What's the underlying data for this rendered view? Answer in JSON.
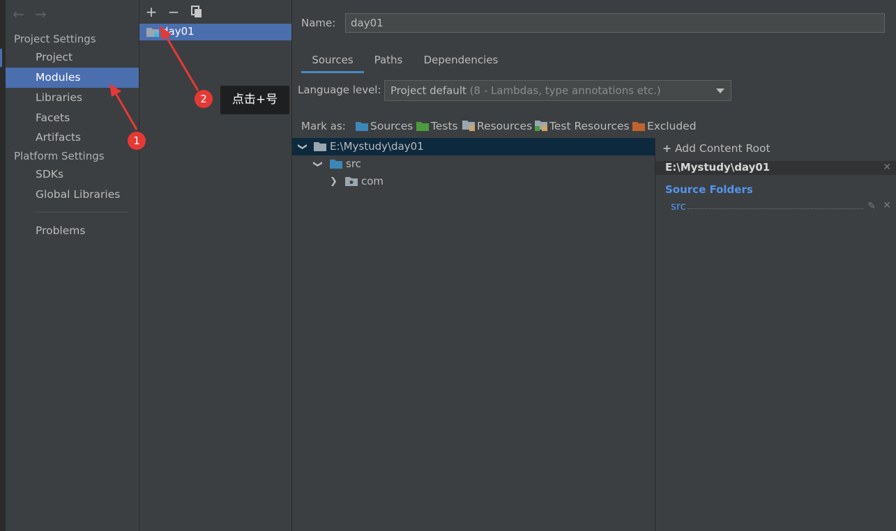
{
  "sidebar": {
    "project_settings_heading": "Project Settings",
    "platform_settings_heading": "Platform Settings",
    "items": {
      "project": "Project",
      "modules": "Modules",
      "libraries": "Libraries",
      "facets": "Facets",
      "artifacts": "Artifacts",
      "sdks": "SDKs",
      "global_libraries": "Global Libraries",
      "problems": "Problems"
    },
    "selected": "Modules"
  },
  "module_panel": {
    "toolbar": {
      "add": "+",
      "remove": "−",
      "copy": "copy"
    },
    "modules": [
      "day01"
    ]
  },
  "module_editor": {
    "name_label": "Name:",
    "name_value": "day01",
    "tabs": [
      "Sources",
      "Paths",
      "Dependencies"
    ],
    "active_tab": "Sources",
    "language_level_label": "Language level:",
    "language_level_value": "Project default",
    "language_level_detail": "(8 - Lambdas, type annotations etc.)",
    "mark_as_label": "Mark as:",
    "mark_as": {
      "sources": "Sources",
      "tests": "Tests",
      "resources": "Resources",
      "test_resources": "Test Resources",
      "excluded": "Excluded"
    },
    "tree": {
      "root": "E:\\Mystudy\\day01",
      "src": "src",
      "com": "com"
    },
    "content_root": {
      "add_label": "Add Content Root",
      "path": "E:\\Mystudy\\day01",
      "source_folders_heading": "Source Folders",
      "source_folders": [
        "src"
      ]
    }
  },
  "annotations": {
    "badge1": "1",
    "badge2": "2",
    "callout": "点击+号",
    "color": "#e53935"
  },
  "colors": {
    "selection": "#4b6eaf",
    "tree_selection": "#0d293e",
    "source_folder_blue": "#5394ec",
    "folder_sources": "#3d87b8",
    "folder_tests": "#4e9a3f",
    "folder_excluded": "#c0642d"
  }
}
